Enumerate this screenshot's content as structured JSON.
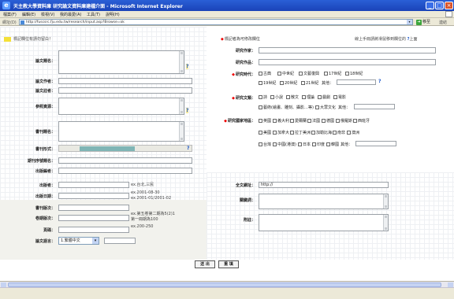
{
  "window": {
    "title": "天主教大學資料庫 研究論文資料庫建檔介面 - Microsoft Internet Explorer",
    "controls": [
      "_",
      "□",
      "×"
    ]
  },
  "menubar": [
    "檔案(F)",
    "編輯(E)",
    "檢視(V)",
    "我的最愛(A)",
    "工具(T)",
    "說明(H)"
  ],
  "addressbar": {
    "label": "網址(D)",
    "url": "http://fuscsrc.fju.edu.tw/research/input.asp?Browse=ok",
    "go_label": "移至",
    "links_label": "連結"
  },
  "header": {
    "left_notice": "標記欄位有請勿留白！",
    "right_notice": "標記者為可修改欄位",
    "far_right_notice": "線上手冊請將滑鼠移到欄位的",
    "far_right_suffix": "上面"
  },
  "left_form": {
    "title_label": "論文題名：",
    "author_label": "論文作者：",
    "advisor_label": "論文註者：",
    "reference_label": "參照資源：",
    "book_title_label": "書刊題名：",
    "book_format_label": "書刊形式：",
    "periodical_no_label": "期刊序號題名：",
    "editor_label": "出版編者：",
    "publisher_label": "出版者：",
    "publisher_hint": "ex.台北,三民",
    "date_label": "出版日期：",
    "date_hint_1": "ex.2001-08-30",
    "date_hint_2": "ex.2001-01/2001-02",
    "edition_label": "書刊版次：",
    "volume_label": "卷期版次：",
    "volume_hint_1": "ex.第五卷第二期為5(2)1",
    "volume_hint_2": "第一冊期為100",
    "pages_label": "頁碼：",
    "pages_hint": "ex.200-250",
    "language_label": "論文語言：",
    "language_value": "1.繁體中文"
  },
  "right_form": {
    "research_author_label": "研究作家：",
    "research_work_label": "研究作品：",
    "period_label": "研究時代：",
    "period_options_row1": [
      "古典",
      "中世紀",
      "文藝復興",
      "17世紀",
      "18世紀"
    ],
    "period_options_row2": [
      "19世紀",
      "20世紀",
      "21世紀"
    ],
    "period_other": "其他：",
    "genre_label": "研究文類：",
    "genre_options_row1": [
      "詩",
      "小說",
      "散文",
      "理論",
      "戲劇",
      "電影"
    ],
    "genre_options_row2": [
      "藝術(繪畫、雕刻、攝影…等)",
      "大眾文化"
    ],
    "genre_other": "其他：",
    "country_label": "研究國家地區：",
    "country_options_row1": [
      "英國",
      "義大利",
      "愛爾蘭",
      "法國",
      "德國",
      "俄羅斯",
      "西班牙"
    ],
    "country_options_row2": [
      "美國",
      "加拿大",
      "拉丁美洲",
      "加勒比海",
      "南非",
      "澳洲"
    ],
    "country_options_row3": [
      "台灣",
      "中國(港澳)",
      "日本",
      "印度",
      "韓國"
    ],
    "country_other": "其他：",
    "fulltext_label": "全文網址：",
    "fulltext_value": "http://",
    "keyword_label": "關鍵詞：",
    "notes_label": "附註："
  },
  "buttons": {
    "submit": "送 出",
    "reset": "重 填"
  },
  "help_glyph": "?",
  "statusbar": {
    "text": ""
  }
}
